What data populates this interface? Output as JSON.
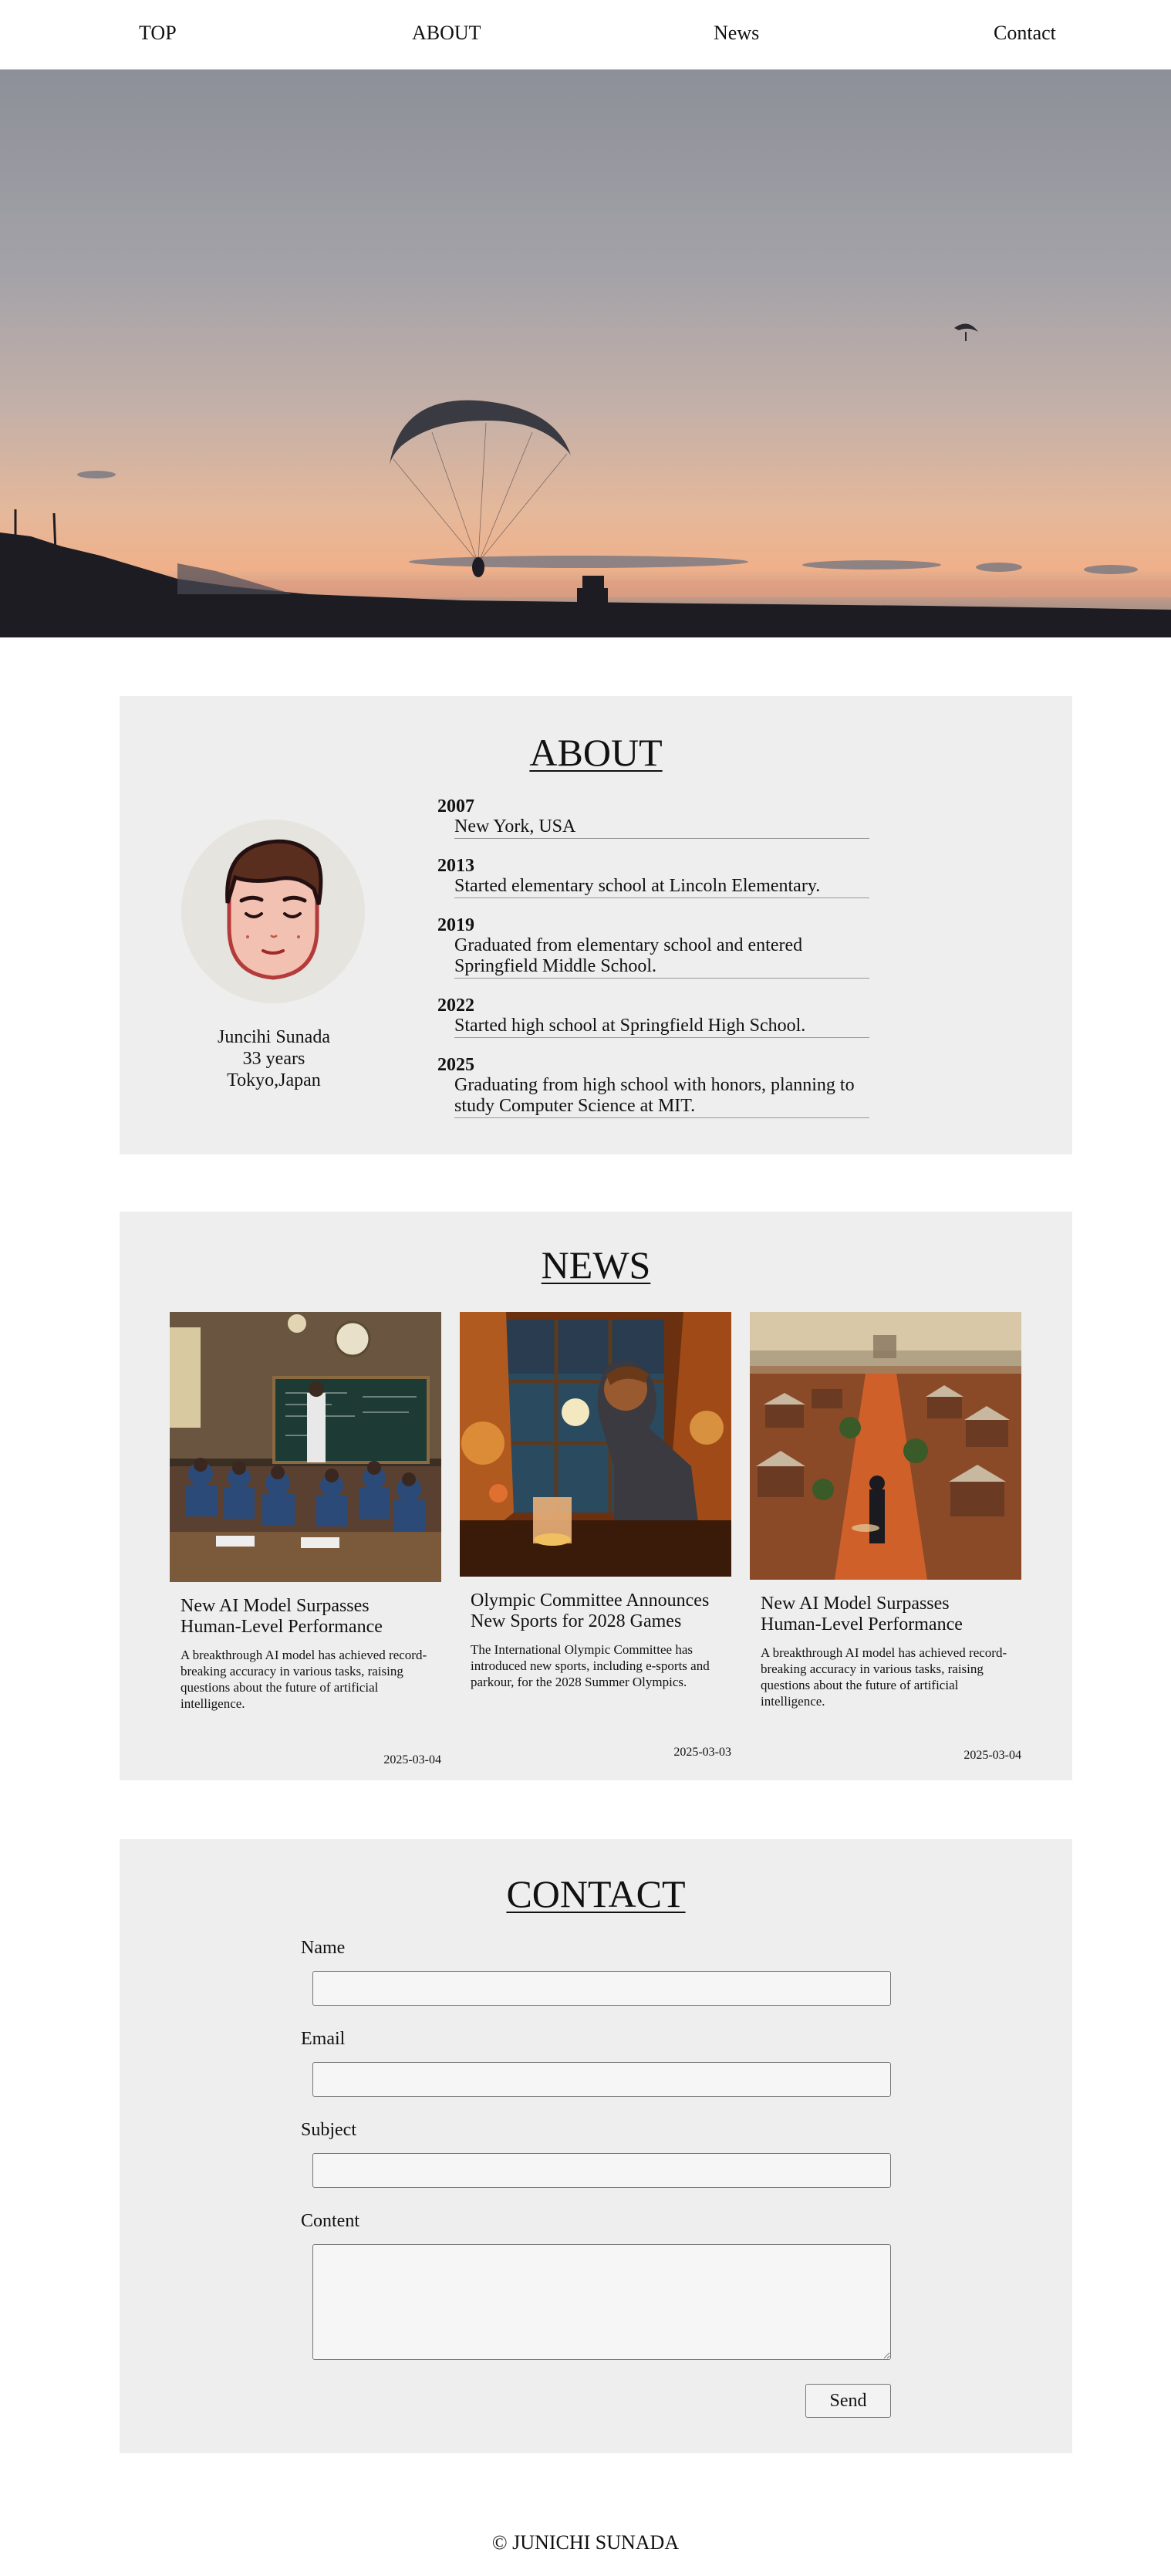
{
  "nav": {
    "items": [
      {
        "label": "TOP"
      },
      {
        "label": "ABOUT"
      },
      {
        "label": "News"
      },
      {
        "label": "Contact"
      }
    ]
  },
  "about": {
    "title": "ABOUT",
    "profile": {
      "name": "Juncihi Sunada",
      "age": "33 years",
      "location": "Tokyo,Japan"
    },
    "timeline": [
      {
        "year": "2007",
        "text": "New York, USA"
      },
      {
        "year": "2013",
        "text": "Started elementary school at Lincoln Elementary."
      },
      {
        "year": "2019",
        "text": "Graduated from elementary school and entered Springfield Middle School."
      },
      {
        "year": "2022",
        "text": "Started high school at Springfield High School."
      },
      {
        "year": "2025",
        "text": "Graduating from high school with honors, planning to study Computer Science at MIT."
      }
    ]
  },
  "news": {
    "title": "NEWS",
    "articles": [
      {
        "title": "New AI Model Surpasses Human-Level Performance",
        "description": "A breakthrough AI model has achieved record-breaking accuracy in various tasks, raising questions about the future of artificial intelligence.",
        "date": "2025-03-04"
      },
      {
        "title": "Olympic Committee Announces New Sports for 2028 Games",
        "description": "The International Olympic Committee has introduced new sports, including e-sports and parkour, for the 2028 Summer Olympics.",
        "date": "2025-03-03"
      },
      {
        "title": "New AI Model Surpasses Human-Level Performance",
        "description": "A breakthrough AI model has achieved record-breaking accuracy in various tasks, raising questions about the future of artificial intelligence.",
        "date": "2025-03-04"
      }
    ]
  },
  "contact": {
    "title": "CONTACT",
    "fields": {
      "name_label": "Name",
      "email_label": "Email",
      "subject_label": "Subject",
      "content_label": "Content",
      "name_value": "",
      "email_value": "",
      "subject_value": "",
      "content_value": ""
    },
    "send_label": "Send"
  },
  "footer": {
    "copyright": "© JUNICHI SUNADA"
  },
  "colors": {
    "section_bg": "#eeeeee",
    "page_bg": "#ffffff",
    "text": "#111111"
  }
}
